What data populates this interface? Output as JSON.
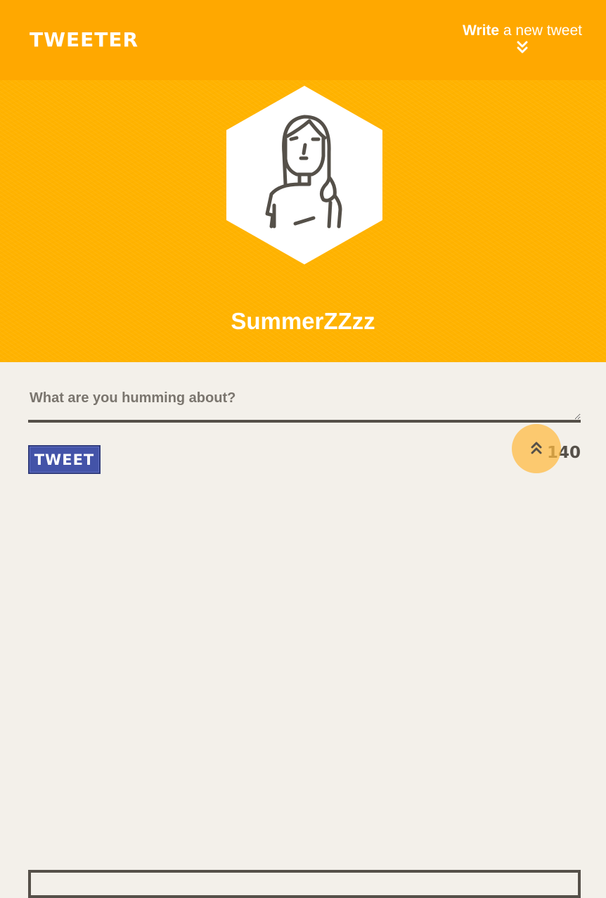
{
  "header": {
    "logo_text": "TWEETER",
    "compose_toggle": {
      "bold_text": "Write",
      "rest_text": "a new tweet",
      "icon": "double-chevron-down-icon"
    }
  },
  "profile": {
    "avatar_icon": "user-avatar-icon",
    "username": "SummerZZzz"
  },
  "composer": {
    "placeholder": "What are you humming about?",
    "value": "",
    "submit_label": "TWEET",
    "char_counter": "140"
  },
  "scroll_top": {
    "icon": "double-chevron-up-icon"
  },
  "colors": {
    "nav_bg": "#ffa800",
    "profile_bg": "#ffb300",
    "page_bg": "#f3f0ea",
    "button_bg": "#4353a8",
    "dark_text": "#555049",
    "scroll_button": "#ffba40"
  }
}
